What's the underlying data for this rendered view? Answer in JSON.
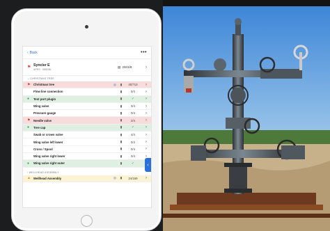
{
  "header": {
    "back_label": "Back",
    "more": "•••"
  },
  "asset": {
    "name": "Syncler E",
    "subtitle": "APRS · 985DBL",
    "count": "2/8/3/8"
  },
  "sections": {
    "christmas_tree": "CHRISTMAS TREE",
    "wellhead": "WELLHEAD ASSEMBLY"
  },
  "rows": [
    {
      "label": "Christmas tree",
      "value": "40/?13",
      "status": "red",
      "row": "red",
      "extra_icon": true
    },
    {
      "label": "Flow line connection",
      "value": "0/4",
      "status": "",
      "row": ""
    },
    {
      "label": "Test port plugin",
      "value": "✓",
      "status": "green",
      "row": "green"
    },
    {
      "label": "Wing valve",
      "value": "0/4",
      "status": "",
      "row": ""
    },
    {
      "label": "Pressure gauge",
      "value": "0/4",
      "status": "",
      "row": ""
    },
    {
      "label": "Needle valve",
      "value": "2/4",
      "status": "red",
      "row": "red"
    },
    {
      "label": "Tree cap",
      "value": "✓",
      "status": "green",
      "row": "green"
    },
    {
      "label": "Swab or crown valve",
      "value": "4/4",
      "status": "",
      "row": ""
    },
    {
      "label": "Wing valve left lower",
      "value": "0/4",
      "status": "",
      "row": ""
    },
    {
      "label": "Cross / Spool",
      "value": "0/4",
      "status": "",
      "row": ""
    },
    {
      "label": "Wing valve right lower",
      "value": "0/4",
      "status": "",
      "row": ""
    },
    {
      "label": "Wing valve right outer",
      "value": "✓",
      "status": "green",
      "row": "green"
    }
  ],
  "wellhead_row": {
    "label": "Wellhead Assembly",
    "value": "24/169",
    "status": "orange"
  },
  "icons": {
    "back": "chevron-left-icon",
    "flag": "flag-icon",
    "trash": "trash-icon",
    "chevron": "chevron-right-icon",
    "check": "check-icon"
  },
  "colors": {
    "accent": "#2b6fd8",
    "red": "#d9342b",
    "green": "#2aa052",
    "orange": "#e28a14"
  }
}
